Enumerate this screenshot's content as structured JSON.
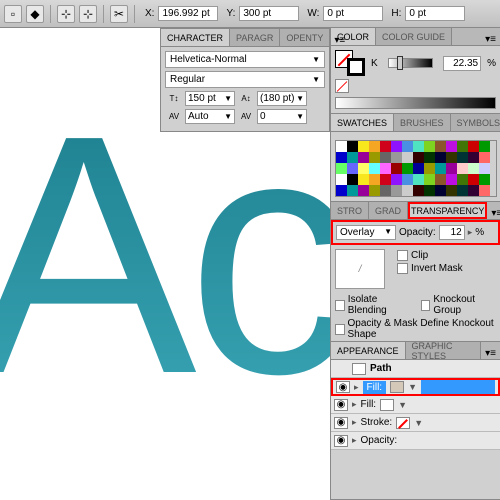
{
  "topbar": {
    "x_label": "X:",
    "x_val": "196.992 pt",
    "y_label": "Y:",
    "y_val": "300 pt",
    "w_label": "W:",
    "w_val": "0 pt",
    "h_label": "H:",
    "h_val": "0 pt"
  },
  "canvas": {
    "text": "Ac"
  },
  "character": {
    "tabs": [
      "CHARACTER",
      "PARAGR",
      "OPENTY"
    ],
    "font": "Helvetica-Normal",
    "style": "Regular",
    "size": "150 pt",
    "leading": "(180 pt)",
    "kerning": "Auto",
    "tracking": "0"
  },
  "color": {
    "tabs": [
      "COLOR",
      "COLOR GUIDE"
    ],
    "mode": "K",
    "value": "22.35",
    "unit": "%"
  },
  "swatches": {
    "tabs": [
      "SWATCHES",
      "BRUSHES",
      "SYMBOLS"
    ]
  },
  "stroke": {
    "tabs": [
      "STRO",
      "GRAD",
      "TRANSPARENCY"
    ],
    "blend": "Overlay",
    "opacity_label": "Opacity:",
    "opacity": "12",
    "unit": "%",
    "clip": "Clip",
    "invert": "Invert Mask",
    "isolate": "Isolate Blending",
    "knockout": "Knockout Group",
    "define": "Opacity & Mask Define Knockout Shape"
  },
  "appearance": {
    "tabs": [
      "APPEARANCE",
      "GRAPHIC STYLES"
    ],
    "path": "Path",
    "fill": "Fill:",
    "stroke": "Stroke:",
    "opacity": "Opacity:"
  }
}
